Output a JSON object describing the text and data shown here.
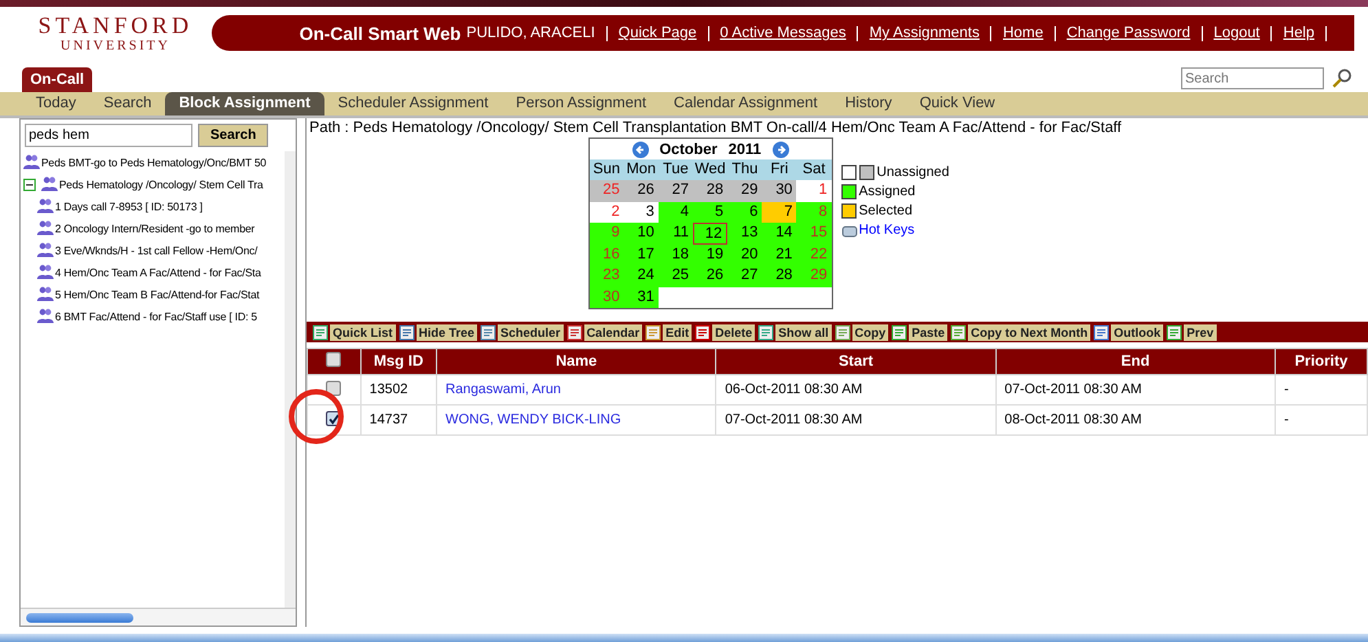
{
  "logo": {
    "name": "STANFORD",
    "sub": "UNIVERSITY"
  },
  "header": {
    "app_title": "On-Call Smart Web",
    "user": "PULIDO, ARACELI",
    "links": [
      "Quick Page",
      "0 Active Messages",
      "My Assignments",
      "Home",
      "Change Password",
      "Logout",
      "Help"
    ]
  },
  "top_tab": {
    "label": "On-Call"
  },
  "search": {
    "placeholder": "Search"
  },
  "nav": [
    {
      "label": "Today",
      "selected": false
    },
    {
      "label": "Search",
      "selected": false
    },
    {
      "label": "Block Assignment",
      "selected": true
    },
    {
      "label": "Scheduler Assignment",
      "selected": false
    },
    {
      "label": "Person Assignment",
      "selected": false
    },
    {
      "label": "Calendar Assignment",
      "selected": false
    },
    {
      "label": "History",
      "selected": false
    },
    {
      "label": "Quick View",
      "selected": false
    }
  ],
  "tree_search": {
    "value": "peds hem",
    "button": "Search"
  },
  "tree": [
    {
      "label": "Peds BMT-go to Peds Hematology/Onc/BMT 50"
    },
    {
      "label": "Peds Hematology /Oncology/ Stem Cell Tra",
      "expanded": true,
      "children": [
        {
          "label": "1 Days call 7-8953 [ ID: 50173 ]"
        },
        {
          "label": "2 Oncology Intern/Resident -go to member"
        },
        {
          "label": "3 Eve/Wknds/H - 1st call Fellow -Hem/Onc/"
        },
        {
          "label": "4 Hem/Onc Team A Fac/Attend - for Fac/Sta"
        },
        {
          "label": "5 Hem/Onc Team B Fac/Attend-for Fac/Stat"
        },
        {
          "label": "6 BMT Fac/Attend - for Fac/Staff use [ ID: 5"
        }
      ]
    }
  ],
  "path": "Path : Peds Hematology /Oncology/ Stem Cell Transplantation BMT On-call/4 Hem/Onc Team A Fac/Attend - for Fac/Staff",
  "calendar": {
    "month": "October",
    "year": "2011",
    "weekdays": [
      "Sun",
      "Mon",
      "Tue",
      "Wed",
      "Thu",
      "Fri",
      "Sat"
    ],
    "days": [
      {
        "label": "25",
        "kind": "other"
      },
      {
        "label": "26",
        "kind": "other"
      },
      {
        "label": "27",
        "kind": "other"
      },
      {
        "label": "28",
        "kind": "other"
      },
      {
        "label": "29",
        "kind": "other"
      },
      {
        "label": "30",
        "kind": "other"
      },
      {
        "label": "1",
        "kind": "unassigned"
      },
      {
        "label": "2",
        "kind": "unassigned"
      },
      {
        "label": "3",
        "kind": "unassigned"
      },
      {
        "label": "4",
        "kind": "assigned"
      },
      {
        "label": "5",
        "kind": "assigned"
      },
      {
        "label": "6",
        "kind": "assigned"
      },
      {
        "label": "7",
        "kind": "selected"
      },
      {
        "label": "8",
        "kind": "assigned"
      },
      {
        "label": "9",
        "kind": "assigned"
      },
      {
        "label": "10",
        "kind": "assigned"
      },
      {
        "label": "11",
        "kind": "assigned"
      },
      {
        "label": "12",
        "kind": "assigned",
        "today": true
      },
      {
        "label": "13",
        "kind": "assigned"
      },
      {
        "label": "14",
        "kind": "assigned"
      },
      {
        "label": "15",
        "kind": "assigned"
      },
      {
        "label": "16",
        "kind": "assigned"
      },
      {
        "label": "17",
        "kind": "assigned"
      },
      {
        "label": "18",
        "kind": "assigned"
      },
      {
        "label": "19",
        "kind": "assigned"
      },
      {
        "label": "20",
        "kind": "assigned"
      },
      {
        "label": "21",
        "kind": "assigned"
      },
      {
        "label": "22",
        "kind": "assigned"
      },
      {
        "label": "23",
        "kind": "assigned"
      },
      {
        "label": "24",
        "kind": "assigned"
      },
      {
        "label": "25",
        "kind": "assigned"
      },
      {
        "label": "26",
        "kind": "assigned"
      },
      {
        "label": "27",
        "kind": "assigned"
      },
      {
        "label": "28",
        "kind": "assigned"
      },
      {
        "label": "29",
        "kind": "assigned"
      },
      {
        "label": "30",
        "kind": "assigned"
      },
      {
        "label": "31",
        "kind": "assigned"
      }
    ]
  },
  "legend": [
    {
      "label": "Unassigned",
      "kind": "unassigned"
    },
    {
      "label": "Assigned",
      "kind": "assigned"
    },
    {
      "label": "Selected",
      "kind": "selected"
    }
  ],
  "hot_keys": "Hot Keys",
  "toolbar": [
    "Quick List",
    "Hide Tree",
    "Scheduler",
    "Calendar",
    "Edit",
    "Delete",
    "Show all",
    "Copy",
    "Paste",
    "Copy to Next Month",
    "Outlook",
    "Prev"
  ],
  "table": {
    "columns": [
      "Msg ID",
      "Name",
      "Start",
      "End",
      "Priority"
    ],
    "all_checked": false,
    "rows": [
      {
        "checked": false,
        "cells": [
          "13502",
          "Rangaswami, Arun",
          "06-Oct-2011 08:30 AM",
          "07-Oct-2011 08:30 AM",
          "-"
        ]
      },
      {
        "checked": true,
        "cells": [
          "14737",
          "WONG, WENDY BICK-LING",
          "07-Oct-2011 08:30 AM",
          "08-Oct-2011 08:30 AM",
          "-"
        ]
      }
    ]
  }
}
